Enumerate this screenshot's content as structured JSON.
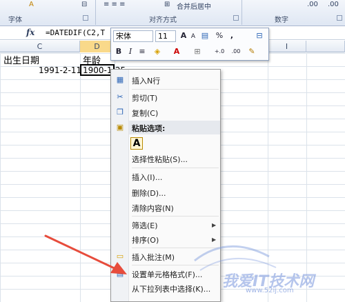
{
  "ribbon": {
    "groups": [
      "字体",
      "对齐方式",
      "数字"
    ],
    "merge_label": "合并后居中",
    "numfmt_a": ".00",
    "numfmt_b": ".00"
  },
  "formula_bar": {
    "fx": "fx",
    "formula": "=DATEDIF(C2,T"
  },
  "columns": [
    "C",
    "D",
    "I"
  ],
  "cells": {
    "c1": "出生日期",
    "d1": "年龄",
    "c2": "1991-2-11",
    "d2": "1900-1-25"
  },
  "mini_toolbar": {
    "font": "宋体",
    "size": "11",
    "grow": "A",
    "shrink": "A",
    "currency": "%",
    "comma": ",",
    "bold": "B",
    "italic": "I",
    "align": "≡",
    "font_color": "A"
  },
  "context_menu": {
    "items": [
      "插入N行",
      "剪切(T)",
      "复制(C)",
      "粘贴选项:",
      "选择性粘贴(S)...",
      "插入(I)...",
      "删除(D)...",
      "清除内容(N)",
      "筛选(E)",
      "排序(O)",
      "插入批注(M)",
      "设置单元格格式(F)...",
      "从下拉列表中选择(K)..."
    ],
    "paste_icon": "A"
  },
  "watermark": {
    "text": "我爱IT技术网",
    "url": "www.52ij.com"
  },
  "colors": {
    "accent": "#e74c3c",
    "ribbon": "#dfe7f3"
  }
}
